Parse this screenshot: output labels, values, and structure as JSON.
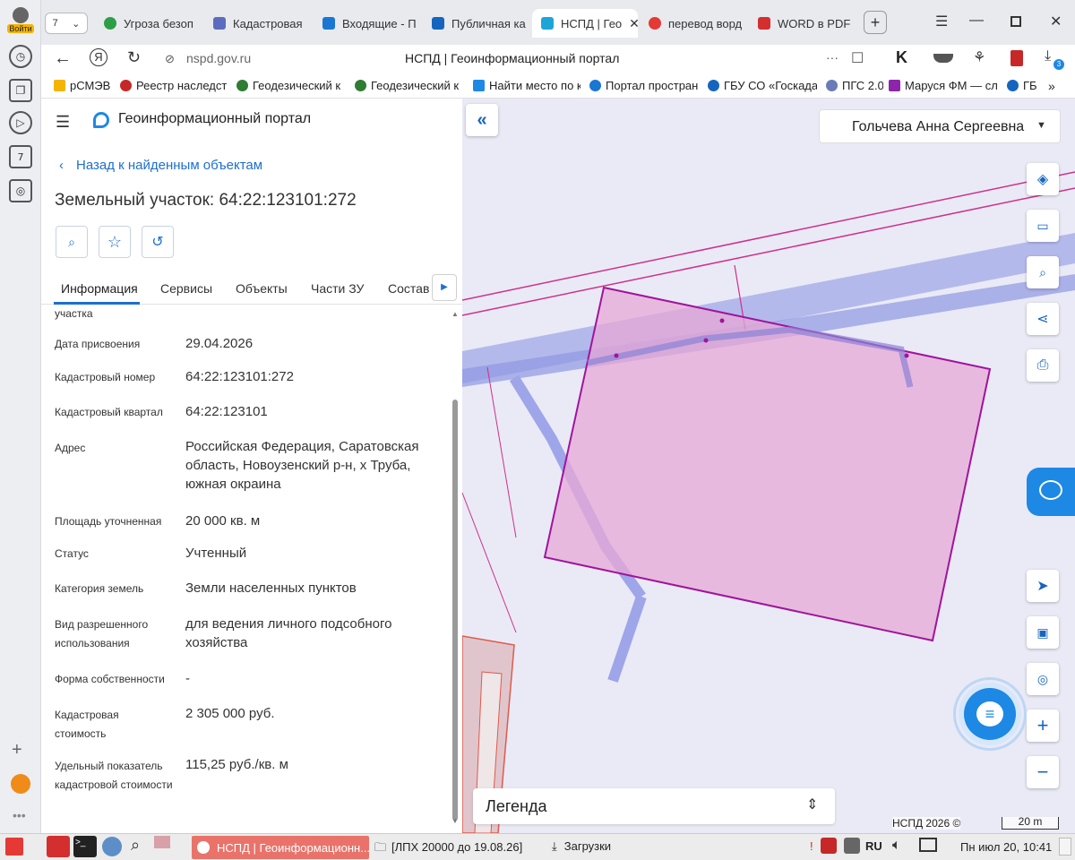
{
  "sidebar": {
    "login_label": "Войти",
    "counter": "7"
  },
  "tabs": {
    "count": "7",
    "items": [
      {
        "label": "Угроза безоп",
        "color": "#2e9e46"
      },
      {
        "label": "Кадастровая",
        "color": "#5c6bc0"
      },
      {
        "label": "Входящие - П",
        "color": "#1976d2"
      },
      {
        "label": "Публичная ка",
        "color": "#1565c0"
      },
      {
        "label": "НСПД | Гео",
        "color": "#1ea5d8",
        "active": true
      },
      {
        "label": "перевод ворд",
        "color": "#e53935"
      },
      {
        "label": "WORD в PDF",
        "color": "#d32f2f"
      }
    ]
  },
  "addressbar": {
    "url": "nspd.gov.ru",
    "page_title": "НСПД | Геоинформационный портал",
    "downloads_badge": "3"
  },
  "bookmarks": [
    {
      "label": "рСМЭВ",
      "color": "#f4b400"
    },
    {
      "label": "Реестр наследств",
      "color": "#c62828"
    },
    {
      "label": "Геодезический к",
      "color": "#2e7d32"
    },
    {
      "label": "Геодезический к",
      "color": "#2e7d32"
    },
    {
      "label": "Найти место по к",
      "color": "#1e88e5"
    },
    {
      "label": "Портал простран",
      "color": "#1976d2"
    },
    {
      "label": "ГБУ СО «Госкадас",
      "color": "#1565c0"
    },
    {
      "label": "ПГС 2.0",
      "color": "#6a7bb8"
    },
    {
      "label": "Маруся ФМ — слу",
      "color": "#8e24aa"
    },
    {
      "label": "ГБ",
      "color": "#1565c0"
    }
  ],
  "portal": {
    "title": "Геоинформационный портал",
    "back_link": "Назад к найденным объектам",
    "object_title": "Земельный участок: 64:22:123101:272",
    "tabs": [
      "Информация",
      "Сервисы",
      "Объекты",
      "Части ЗУ",
      "Состав"
    ],
    "partial_label": "участка",
    "fields": [
      {
        "label": "Дата присвоения",
        "value": "29.04.2026"
      },
      {
        "label": "Кадастровый номер",
        "value": "64:22:123101:272"
      },
      {
        "label": "Кадастровый квартал",
        "value": "64:22:123101"
      },
      {
        "label": "Адрес",
        "value": "Российская Федерация, Саратовская область, Новоузенский р-н, х Труба, южная окраина"
      },
      {
        "label": "Площадь уточненная",
        "value": "20 000 кв. м"
      },
      {
        "label": "Статус",
        "value": "Учтенный"
      },
      {
        "label": "Категория земель",
        "value": "Земли населенных пунктов"
      },
      {
        "label": "Вид разрешенного использования",
        "value": "для ведения личного подсобного хозяйства"
      },
      {
        "label": "Форма собственности",
        "value": "-"
      },
      {
        "label": "Кадастровая стоимость",
        "value": "2 305 000 руб."
      },
      {
        "label": "Удельный показатель кадастровой стоимости",
        "value": "115,25 руб./кв. м"
      }
    ]
  },
  "map": {
    "user_name": "Гольчева Анна Сергеевна",
    "legend_label": "Легенда",
    "copyright": "НСПД 2026 ©",
    "scale": "20 m"
  },
  "taskbar": {
    "window1": "НСПД | Геоинформационн...",
    "window2": "[ЛПХ 20000 до 19.08.26]",
    "window3": "Загрузки",
    "lang": "RU",
    "clock": "Пн июл 20, 10:41"
  }
}
